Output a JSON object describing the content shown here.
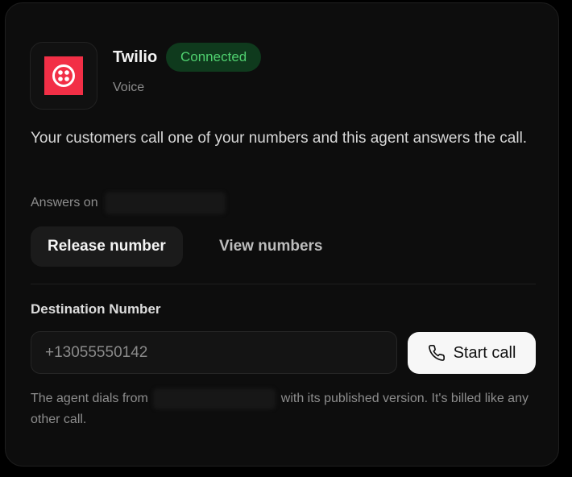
{
  "integration": {
    "name": "Twilio",
    "status": "Connected",
    "type": "Voice",
    "brand_color": "#f22f46",
    "status_color": "#4fd06f",
    "icon": "twilio-logo-icon"
  },
  "description": "Your customers call one of your numbers and this agent answers the call.",
  "answers": {
    "label": "Answers on"
  },
  "actions": {
    "release_label": "Release number",
    "view_label": "View numbers"
  },
  "destination": {
    "label": "Destination Number",
    "placeholder": "+13055550142",
    "value": "",
    "call_label": "Start call",
    "call_icon": "phone-icon"
  },
  "footer": {
    "prefix": "The agent dials from",
    "suffix": "with its published version. It's billed like any other call."
  }
}
